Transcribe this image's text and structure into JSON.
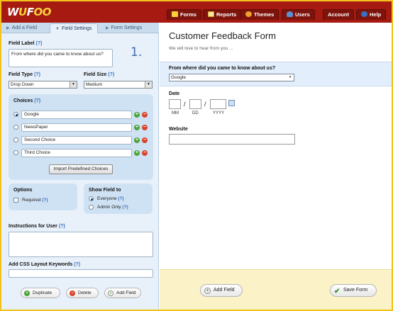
{
  "app": {
    "logo_prefix": "W",
    "logo_o1": "U",
    "logo_rest": "F",
    "logo_o2": "OO"
  },
  "nav": {
    "forms": "Forms",
    "reports": "Reports",
    "themes": "Themes",
    "users": "Users",
    "account": "Account",
    "help": "Help"
  },
  "tabs": {
    "add_field": "Add a Field",
    "field_settings": "Field Settings",
    "form_settings": "Form Settings"
  },
  "field_settings": {
    "field_label_title": "Field Label",
    "help": "(?)",
    "field_label_value": "From where did you came to know about us?",
    "field_number": "1.",
    "field_type_title": "Field Type",
    "field_type_value": "Drop Down",
    "field_size_title": "Field Size",
    "field_size_value": "Medium",
    "choices_title": "Choices",
    "choices": [
      "Google",
      "NewsPaper",
      "Second Choice",
      "Third Choice"
    ],
    "import_label": "Import Predefined Choices",
    "options_title": "Options",
    "required_label": "Required",
    "show_field_title": "Show Field to",
    "everyone_label": "Everyone",
    "admin_only_label": "Admin Only",
    "instructions_title": "Instructions for User",
    "css_title": "Add CSS Layout Keywords",
    "duplicate_label": "Duplicate",
    "delete_label": "Delete",
    "add_field_label": "Add Field"
  },
  "form": {
    "title": "Customer Feedback Form",
    "description": "We will love to hear from you ...",
    "q1_label": "From where did you came to know about us?",
    "q1_value": "Google",
    "date_label": "Date",
    "date_sep": "/",
    "date_mm": "MM",
    "date_dd": "DD",
    "date_yyyy": "YYYY",
    "website_label": "Website",
    "add_field_button": "Add Field",
    "save_form_button": "Save Form"
  },
  "colors": {
    "header": "#a71a12",
    "panel": "#e8f1fa",
    "footer": "#fbf3c7",
    "accent": "#3a6fbf"
  }
}
